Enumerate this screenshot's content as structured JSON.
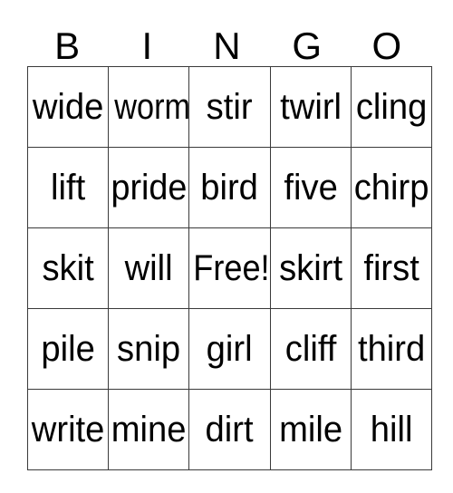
{
  "card": {
    "title": "BINGO",
    "header_letters": [
      "B",
      "I",
      "N",
      "G",
      "O"
    ],
    "free_space_label": "Free!",
    "grid_border_color": "#3a3a3a",
    "text_color": "#000000",
    "background_color": "#ffffff",
    "rows": [
      [
        "wide",
        "worm",
        "stir",
        "twirl",
        "cling"
      ],
      [
        "lift",
        "pride",
        "bird",
        "five",
        "chirp"
      ],
      [
        "skit",
        "will",
        "Free!",
        "skirt",
        "first"
      ],
      [
        "pile",
        "snip",
        "girl",
        "cliff",
        "third"
      ],
      [
        "write",
        "mine",
        "dirt",
        "mile",
        "hill"
      ]
    ]
  }
}
